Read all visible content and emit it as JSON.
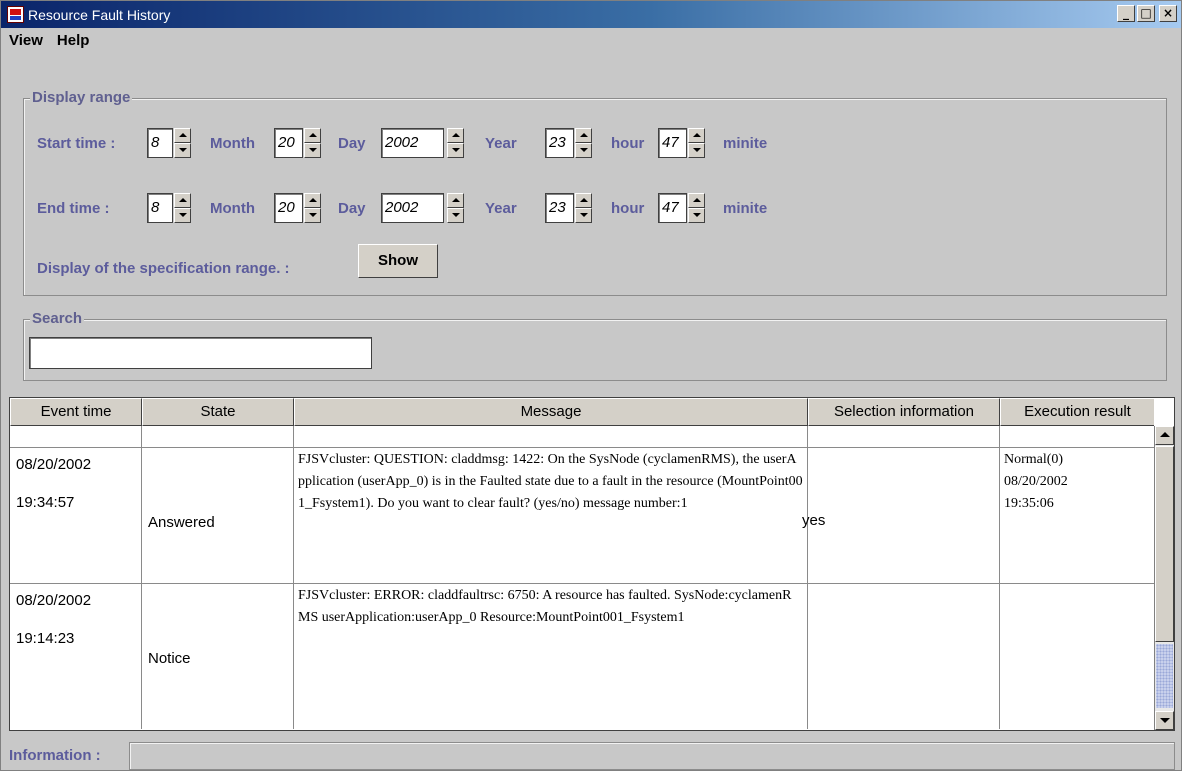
{
  "window": {
    "title": "Resource Fault History",
    "minimize": "_",
    "maximize": "□",
    "close": "×"
  },
  "menu": {
    "view": "View",
    "help": "Help"
  },
  "display_range": {
    "title": "Display range",
    "start_label": "Start time :",
    "end_label": "End time :",
    "month_label": "Month",
    "day_label": "Day",
    "year_label": "Year",
    "hour_label": "hour",
    "minute_label": "minite",
    "start": {
      "month": "8",
      "day": "20",
      "year": "2002",
      "hour": "23",
      "minute": "47"
    },
    "end": {
      "month": "8",
      "day": "20",
      "year": "2002",
      "hour": "23",
      "minute": "47"
    },
    "spec_label": "Display of the specification range. :",
    "show_button": "Show"
  },
  "search": {
    "title": "Search",
    "value": ""
  },
  "table": {
    "headers": [
      "Event time",
      "State",
      "Message",
      "Selection information",
      "Execution result"
    ],
    "rows": [
      {
        "date": "08/20/2002",
        "time": "19:34:57",
        "state": "Answered",
        "message": "FJSVcluster: QUESTION: claddmsg: 1422: On the SysNode (cyclamenRMS), the userApplication (userApp_0) is in the Faulted state due to a fault in the resource (MountPoint001_Fsystem1). Do you want to clear fault? (yes/no) message number:1",
        "selection": "yes",
        "result_status": "Normal(0)",
        "result_date": "08/20/2002",
        "result_time": "19:35:06"
      },
      {
        "date": "08/20/2002",
        "time": "19:14:23",
        "state": "Notice",
        "message": "FJSVcluster: ERROR: claddfaultrsc: 6750: A resource has faulted. SysNode:cyclamenRMS userApplication:userApp_0 Resource:MountPoint001_Fsystem1",
        "selection": "",
        "result_status": "",
        "result_date": "",
        "result_time": ""
      }
    ]
  },
  "information": {
    "label": "Information :",
    "value": ""
  }
}
